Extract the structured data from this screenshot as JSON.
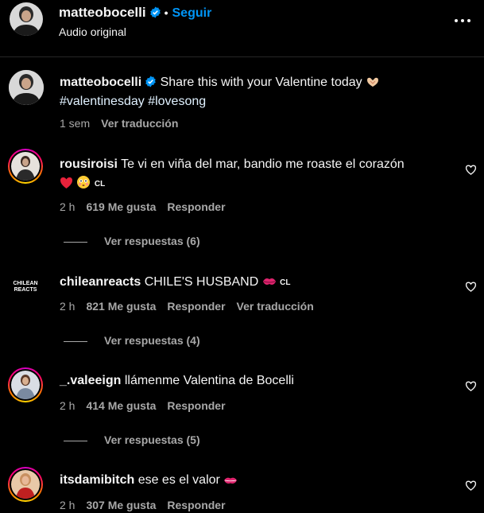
{
  "header": {
    "username": "matteobocelli",
    "dot": "•",
    "follow_label": "Seguir",
    "subtitle": "Audio original"
  },
  "caption": {
    "username": "matteobocelli",
    "text": "Share this with your Valentine today",
    "hashtags": "#valentinesday #lovesong",
    "time": "1 sem",
    "translate_label": "Ver traducción"
  },
  "comments": [
    {
      "username": "rousiroisi",
      "text": "Te vi en viña del mar, bandio me roaste el corazón",
      "flag": "CL",
      "time": "2 h",
      "likes": "619 Me gusta",
      "reply_label": "Responder",
      "replies_label": "Ver respuestas (6)"
    },
    {
      "username": "chileanreacts",
      "text": "CHILE'S HUSBAND",
      "flag": "CL",
      "time": "2 h",
      "likes": "821 Me gusta",
      "reply_label": "Responder",
      "translate_label": "Ver traducción",
      "replies_label": "Ver respuestas (4)",
      "avatar_text": "CHILEAN REACTS"
    },
    {
      "username": "_.valeeign",
      "text": "llámenme Valentina de Bocelli",
      "time": "2 h",
      "likes": "414 Me gusta",
      "reply_label": "Responder",
      "replies_label": "Ver respuestas (5)"
    },
    {
      "username": "itsdamibitch",
      "text": "ese es el valor",
      "time": "2 h",
      "likes": "307 Me gusta",
      "reply_label": "Responder"
    }
  ],
  "colors": {
    "background": "#000000",
    "text": "#f5f5f5",
    "secondary": "#a8a8a8",
    "accent": "#0095f6",
    "verified": "#0095f6"
  }
}
